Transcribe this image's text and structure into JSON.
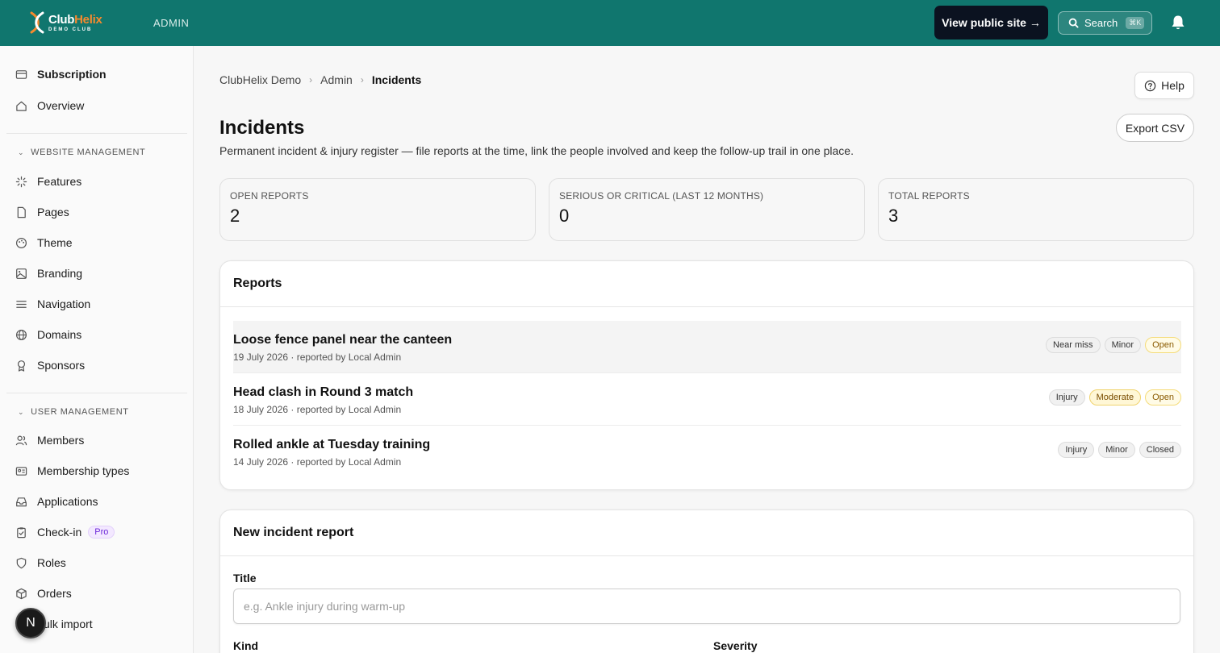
{
  "topbar": {
    "brand_club": "Club",
    "brand_helix": "Helix",
    "brand_sub": "DEMO CLUB",
    "admin_label": "ADMIN",
    "public_site_label": "View public site →",
    "search_label": "Search",
    "search_shortcut": "⌘K",
    "colors": {
      "bar": "#10766e",
      "accent": "#f58a2e",
      "button_dark": "#0b1220"
    }
  },
  "sidebar": {
    "top_items": [
      {
        "label": "Subscription",
        "icon": "card-icon"
      },
      {
        "label": "Overview",
        "icon": "home-icon"
      }
    ],
    "website_management": {
      "header": "WEBSITE MANAGEMENT",
      "items": [
        {
          "label": "Features",
          "icon": "sparkle-icon"
        },
        {
          "label": "Pages",
          "icon": "file-icon"
        },
        {
          "label": "Theme",
          "icon": "palette-icon"
        },
        {
          "label": "Branding",
          "icon": "image-icon"
        },
        {
          "label": "Navigation",
          "icon": "menu-icon"
        },
        {
          "label": "Domains",
          "icon": "globe-icon"
        },
        {
          "label": "Sponsors",
          "icon": "award-icon"
        }
      ]
    },
    "user_management": {
      "header": "USER MANAGEMENT",
      "items": [
        {
          "label": "Members",
          "icon": "users-icon"
        },
        {
          "label": "Membership types",
          "icon": "id-card-icon"
        },
        {
          "label": "Applications",
          "icon": "inbox-icon"
        },
        {
          "label": "Check-in",
          "icon": "clipboard-check-icon",
          "badge": "Pro"
        },
        {
          "label": "Roles",
          "icon": "shield-icon"
        },
        {
          "label": "Orders",
          "icon": "box-icon"
        },
        {
          "label": "ulk import",
          "icon": "upload-icon"
        }
      ]
    },
    "avatar_letter": "N"
  },
  "breadcrumb": [
    "ClubHelix Demo",
    "Admin",
    "Incidents"
  ],
  "help_label": "Help",
  "page": {
    "title": "Incidents",
    "description": "Permanent incident & injury register — file reports at the time, link the people involved and keep the follow-up trail in one place.",
    "export_label": "Export CSV"
  },
  "stats": [
    {
      "label": "OPEN REPORTS",
      "value": "2"
    },
    {
      "label": "SERIOUS OR CRITICAL (LAST 12 MONTHS)",
      "value": "0"
    },
    {
      "label": "TOTAL REPORTS",
      "value": "3"
    }
  ],
  "reports": {
    "header": "Reports",
    "items": [
      {
        "title": "Loose fence panel near the canteen",
        "meta": "19 July 2026 · reported by Local Admin",
        "tags": [
          {
            "text": "Near miss",
            "style": "neutral"
          },
          {
            "text": "Minor",
            "style": "neutral"
          },
          {
            "text": "Open",
            "style": "open"
          }
        ]
      },
      {
        "title": "Head clash in Round 3 match",
        "meta": "18 July 2026 · reported by Local Admin",
        "tags": [
          {
            "text": "Injury",
            "style": "neutral"
          },
          {
            "text": "Moderate",
            "style": "moderate"
          },
          {
            "text": "Open",
            "style": "open"
          }
        ]
      },
      {
        "title": "Rolled ankle at Tuesday training",
        "meta": "14 July 2026 · reported by Local Admin",
        "tags": [
          {
            "text": "Injury",
            "style": "neutral"
          },
          {
            "text": "Minor",
            "style": "neutral"
          },
          {
            "text": "Closed",
            "style": "neutral"
          }
        ]
      }
    ]
  },
  "new_report": {
    "header": "New incident report",
    "title_label": "Title",
    "title_placeholder": "e.g. Ankle injury during warm-up",
    "title_value": "",
    "kind_label": "Kind",
    "severity_label": "Severity"
  }
}
